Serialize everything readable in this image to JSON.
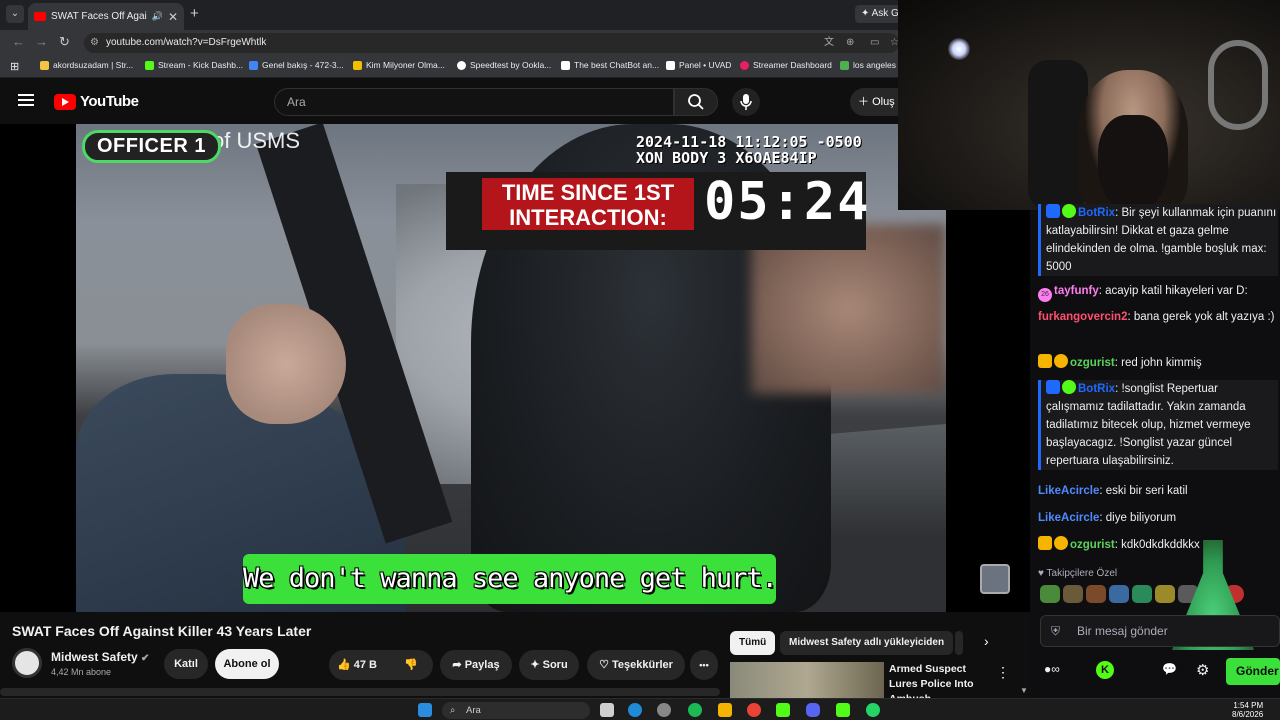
{
  "browser": {
    "tab_title": "SWAT Faces Off Against Kil",
    "url": "youtube.com/watch?v=DsFrgeWhtlk",
    "ask_label": "Ask Ge",
    "bookmarks": [
      {
        "label": "akordsuzadam | Str...",
        "color": "#f4c542"
      },
      {
        "label": "Stream - Kick Dashb...",
        "color": "#53fc18"
      },
      {
        "label": "Genel bakış - 472-3...",
        "color": "#4285f4"
      },
      {
        "label": "Kim Milyoner Olma...",
        "color": "#f0c000"
      },
      {
        "label": "Speedtest by Ookla...",
        "color": "#ffffff"
      },
      {
        "label": "The best ChatBot an...",
        "color": "#ffffff"
      },
      {
        "label": "Panel • UVAD",
        "color": "#ffffff"
      },
      {
        "label": "Streamer Dashboard",
        "color": "#e91e63"
      },
      {
        "label": "los angeles -",
        "color": "#4caf50"
      }
    ]
  },
  "youtube": {
    "logo_text": "YouTube",
    "search_placeholder": "Ara",
    "create_label": "Oluş"
  },
  "video": {
    "officer_label": "OFFICER 1",
    "overlay_text": "of USMS",
    "timestamp_line1": "2024-11-18 11:12:05 -0500",
    "timestamp_line2": "XON BODY 3 X6OAE84IP",
    "time_since_label_1": "TIME SINCE 1ST",
    "time_since_label_2": "INTERACTION:",
    "time_value": "05:24",
    "subtitle": "We don't wanna see anyone get hurt."
  },
  "meta": {
    "title": "SWAT Faces Off Against Killer 43 Years Later",
    "channel": "Midwest Safety",
    "subscribers": "4,42 Mn abone",
    "join_label": "Katıl",
    "subscribe_label": "Abone ol",
    "likes": "47 B",
    "share_label": "Paylaş",
    "ask_label": "Soru",
    "thanks_label": "Teşekkürler",
    "more_label": "•••"
  },
  "recommendations": {
    "chips": [
      "Tümü",
      "Midwest Safety adlı yükleyiciden"
    ],
    "item_title": "Armed Suspect Lures Police Into Ambush"
  },
  "chat": {
    "messages": [
      {
        "user": "BotRix",
        "color": "#1f69ff",
        "text": "Bir şeyi kullanmak için puanını katlayabilirsin! Dikkat et gaza gelme elindekinden de olma. !gamble boşluk max: 5000",
        "highlight": true
      },
      {
        "user": "tayfunfy",
        "color": "#ff7eef",
        "text": "acayip katil hikayeleri var D:"
      },
      {
        "user": "furkangovercin2",
        "color": "#ff4f6d",
        "text": "bana gerek yok alt yazıya :)"
      },
      {
        "user": "ozgurist",
        "color": "#5bd35b",
        "text": "red john kimmiş"
      },
      {
        "user": "BotRix",
        "color": "#1f69ff",
        "text": "!songlist Repertuar çalışmamız tadilattadır. Yakın zamanda tadilatımız bitecek olup, hizmet vermeye başlayacagız. !Songlist yazar güncel repertuara ulaşabilirsiniz.",
        "highlight": true
      },
      {
        "user": "LikeAcircle",
        "color": "#4f8bff",
        "text": "eski bir seri katil"
      },
      {
        "user": "LikeAcircle",
        "color": "#4f8bff",
        "text": "diye biliyorum"
      },
      {
        "user": "ozgurist",
        "color": "#5bd35b",
        "text": "kdk0dkdkddkkx"
      }
    ],
    "followers_label": "♥ Takipçilere Özel",
    "input_placeholder": "Bir mesaj gönder",
    "send_label": "Gönder",
    "tayfun_badge": "26"
  },
  "taskbar": {
    "search_placeholder": "Ara",
    "time": "1:54 PM",
    "date": "8/6/2026"
  }
}
